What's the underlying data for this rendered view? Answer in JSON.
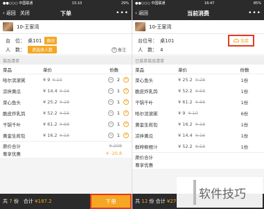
{
  "left": {
    "status": {
      "signal": "●●○○○ 中国联通",
      "time": "15:10",
      "battery": "29%"
    },
    "nav": {
      "back": "返回",
      "close": "关闭",
      "title": "下单",
      "more": "•••"
    },
    "shop": {
      "name": "10-王家湾"
    },
    "table_label": "台　位：",
    "table_value": "桌101",
    "table_tag": "换台",
    "people_label": "人　数：",
    "people_tag": "请选择人数",
    "remark": "备注",
    "remark_icon": "plus-circle-icon",
    "section": "菜品清单",
    "headers": {
      "name": "菜品",
      "price": "单价",
      "qty": "份数"
    },
    "items": [
      {
        "name": "哈尔滨滚粥",
        "price": "¥ 9",
        "orig": "¥ 10",
        "qty": "2"
      },
      {
        "name": "凉拌黄瓜",
        "price": "¥ 14.4",
        "orig": "¥ 16",
        "qty": "1"
      },
      {
        "name": "菜心鱼头",
        "price": "¥ 25.2",
        "orig": "¥ 28",
        "qty": "1"
      },
      {
        "name": "脆皮炸乳鸽",
        "price": "¥ 52.2",
        "orig": "¥ 58",
        "qty": "1"
      },
      {
        "name": "干锅千叶",
        "price": "¥ 61.2",
        "orig": "¥ 68",
        "qty": "1"
      },
      {
        "name": "黄金生煎包",
        "price": "¥ 16.2",
        "orig": "¥ 18",
        "qty": "1"
      }
    ],
    "summary": {
      "total_label": "原价合计",
      "total_value": "¥ 208",
      "discount_label": "尊享优惠",
      "discount_value": "¥ -20.8"
    },
    "bottom": {
      "prefix": "共",
      "count": "7",
      "mid": "份　合计",
      "amount": "¥187.2",
      "submit": "下单"
    }
  },
  "right": {
    "status": {
      "signal": "●●○○○ 中国联通",
      "time": "16:47",
      "battery": "85%"
    },
    "nav": {
      "back": "返回",
      "title": "当前消费",
      "more": "•••"
    },
    "shop": {
      "name": "10-王家湾"
    },
    "table_label": "台位号：",
    "table_value": "桌101",
    "people_label": "人　数：",
    "people_value": "4",
    "add_label": "加菜",
    "section": "已接单菜品清单",
    "headers": {
      "name": "菜品",
      "price": "单价",
      "qty": "份数"
    },
    "items": [
      {
        "name": "菜心鱼头",
        "price": "¥ 25.2",
        "orig": "¥ 28",
        "qty": "1份"
      },
      {
        "name": "脆皮炸乳鸽",
        "price": "¥ 52.2",
        "orig": "¥ 58",
        "qty": "1份"
      },
      {
        "name": "干锅千叶",
        "price": "¥ 61.2",
        "orig": "¥ 68",
        "qty": "1份"
      },
      {
        "name": "哈尔滨滚粥",
        "price": "¥ 9",
        "orig": "¥ 10",
        "qty": "6份"
      },
      {
        "name": "黄金生煎包",
        "price": "¥ 16.2",
        "orig": "¥ 18",
        "qty": "1份"
      },
      {
        "name": "凉拌黄瓜",
        "price": "¥ 14.4",
        "orig": "¥ 16",
        "qty": "1份"
      },
      {
        "name": "鲜榨柳橙汁",
        "price": "¥ 52.2",
        "orig": "¥ 58",
        "qty": "1份"
      }
    ],
    "summary": {
      "total_label": "原价合计",
      "discount_label": "尊享优惠"
    },
    "bottom": {
      "prefix": "共",
      "count": "12",
      "mid": "份 合计",
      "amount": "¥27"
    },
    "watermark": "软件技巧"
  },
  "colors": {
    "accent": "#f5a623",
    "dark": "#2b2b2b",
    "highlight_box": "#e03a1e"
  }
}
